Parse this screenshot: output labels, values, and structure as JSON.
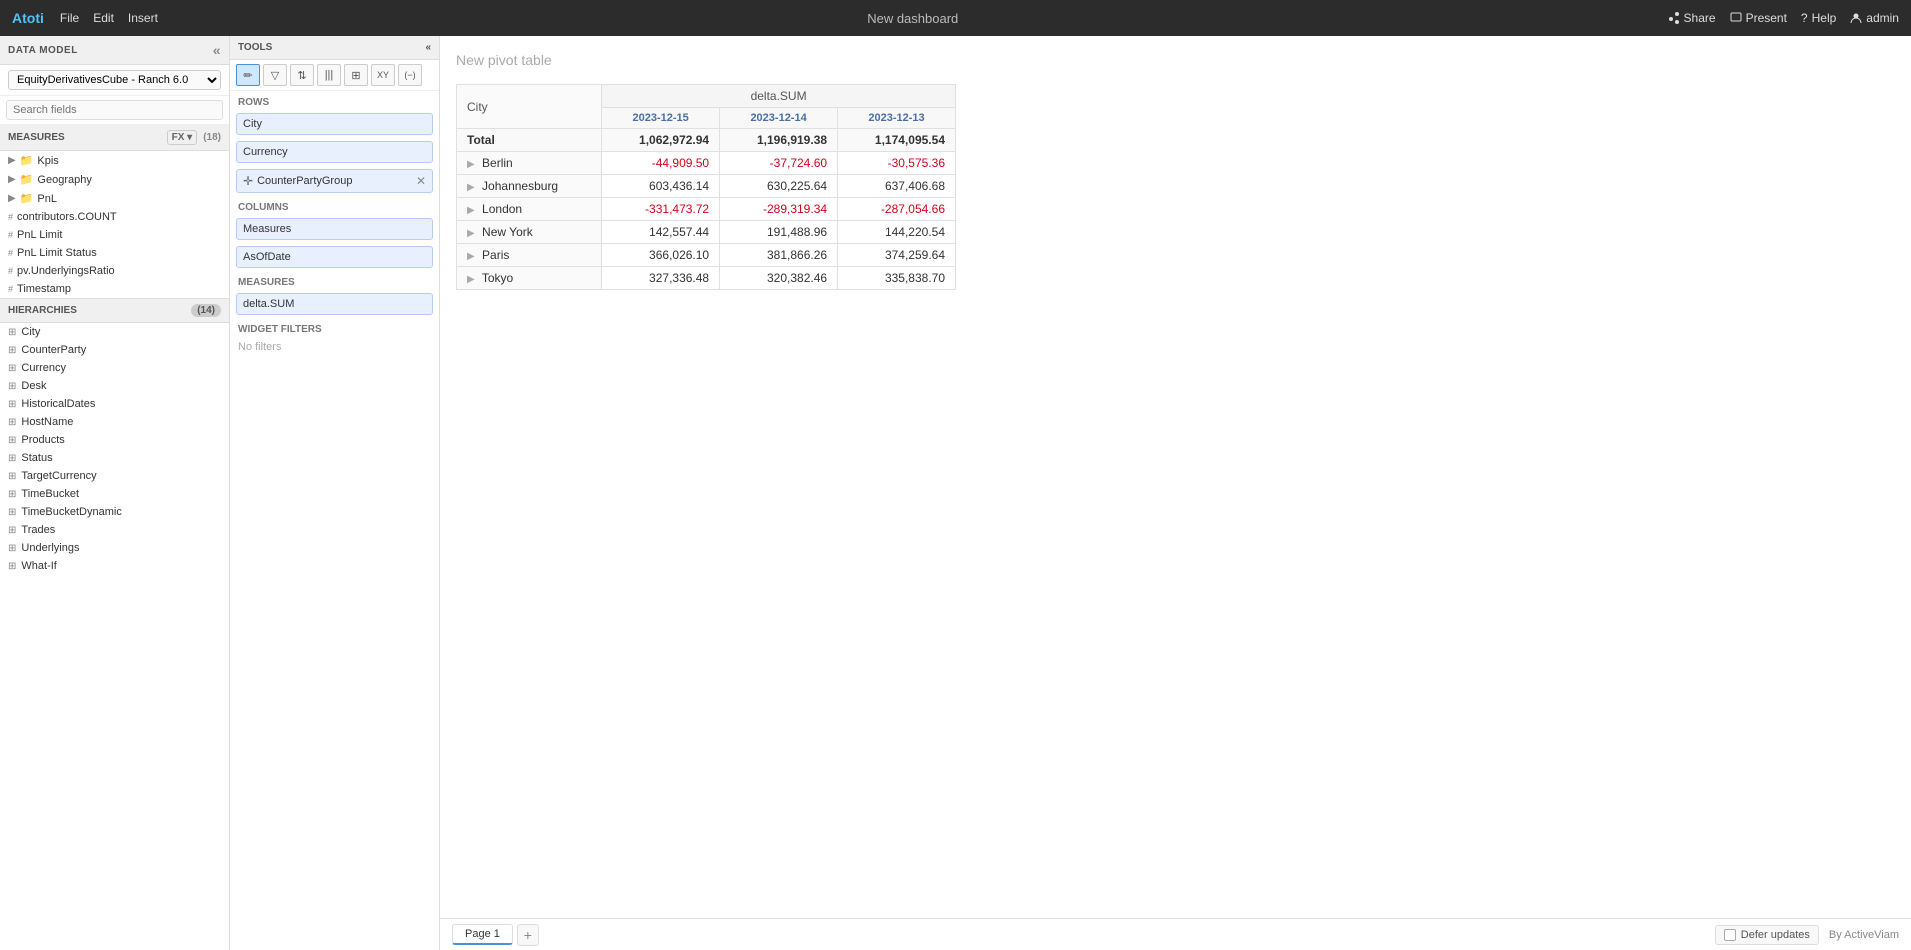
{
  "app": {
    "name": "Atoti",
    "title": "New dashboard"
  },
  "menu": {
    "items": [
      "File",
      "Edit",
      "Insert"
    ]
  },
  "topbar_right": {
    "share": "Share",
    "present": "Present",
    "help": "Help",
    "user": "admin"
  },
  "data_model": {
    "header": "DATA MODEL",
    "cube_name": "EquityDerivativesCube - Ranch 6.0",
    "search_placeholder": "Search fields"
  },
  "measures": {
    "header": "MEASURES",
    "count": "(18)",
    "items": [
      {
        "label": "Kpis",
        "type": "folder"
      },
      {
        "label": "Geography",
        "type": "folder"
      },
      {
        "label": "PnL",
        "type": "folder"
      },
      {
        "label": "contributors.COUNT",
        "type": "measure"
      },
      {
        "label": "PnL Limit",
        "type": "measure"
      },
      {
        "label": "PnL Limit Status",
        "type": "measure"
      },
      {
        "label": "pv.UnderlyingsRatio",
        "type": "measure"
      },
      {
        "label": "Timestamp",
        "type": "measure"
      }
    ]
  },
  "hierarchies": {
    "header": "HIERARCHIES",
    "count": "(14)",
    "items": [
      "City",
      "CounterParty",
      "Currency",
      "Desk",
      "HistoricalDates",
      "HostName",
      "Products",
      "Status",
      "TargetCurrency",
      "TimeBucket",
      "TimeBucketDynamic",
      "Trades",
      "Underlyings",
      "What-If"
    ]
  },
  "tools": {
    "header": "TOOLS",
    "toolbar": [
      {
        "icon": "✏️",
        "name": "edit-tool"
      },
      {
        "icon": "▽",
        "name": "filter-tool"
      },
      {
        "icon": "↕",
        "name": "sort-tool"
      },
      {
        "icon": "|||",
        "name": "columns-tool"
      },
      {
        "icon": "⊞",
        "name": "grid-tool"
      },
      {
        "icon": "XY",
        "name": "xy-tool"
      },
      {
        "icon": "(−)",
        "name": "collapse-tool"
      }
    ]
  },
  "rows": {
    "label": "Rows",
    "items": [
      "City",
      "Currency",
      "CounterPartyGroup"
    ]
  },
  "columns": {
    "label": "Columns",
    "items": [
      "Measures",
      "AsOfDate"
    ]
  },
  "measures_zone": {
    "label": "Measures",
    "items": [
      "delta.SUM"
    ]
  },
  "widget_filters": {
    "label": "Widget filters",
    "no_filters_text": "No filters"
  },
  "pivot": {
    "title": "New pivot table",
    "col_city": "City",
    "col_measure": "delta.SUM",
    "col_dates": [
      "2023-12-15",
      "2023-12-14",
      "2023-12-13"
    ],
    "rows": [
      {
        "city": "Total",
        "v1": "1,062,972.94",
        "v2": "1,196,919.38",
        "v3": "1,174,095.54",
        "total": true
      },
      {
        "city": "Berlin",
        "v1": "-44,909.50",
        "v2": "-37,724.60",
        "v3": "-30,575.36",
        "negative": [
          true,
          true,
          true
        ]
      },
      {
        "city": "Johannesburg",
        "v1": "603,436.14",
        "v2": "630,225.64",
        "v3": "637,406.68",
        "negative": [
          false,
          false,
          false
        ]
      },
      {
        "city": "London",
        "v1": "-331,473.72",
        "v2": "-289,319.34",
        "v3": "-287,054.66",
        "negative": [
          true,
          true,
          true
        ]
      },
      {
        "city": "New York",
        "v1": "142,557.44",
        "v2": "191,488.96",
        "v3": "144,220.54",
        "negative": [
          false,
          false,
          false
        ]
      },
      {
        "city": "Paris",
        "v1": "366,026.10",
        "v2": "381,866.26",
        "v3": "374,259.64",
        "negative": [
          false,
          false,
          false
        ]
      },
      {
        "city": "Tokyo",
        "v1": "327,336.48",
        "v2": "320,382.46",
        "v3": "335,838.70",
        "negative": [
          false,
          false,
          false
        ]
      }
    ]
  },
  "bottom": {
    "pages": [
      "Page 1"
    ],
    "defer_updates": "Defer updates",
    "by_label": "By ActiveViam"
  }
}
